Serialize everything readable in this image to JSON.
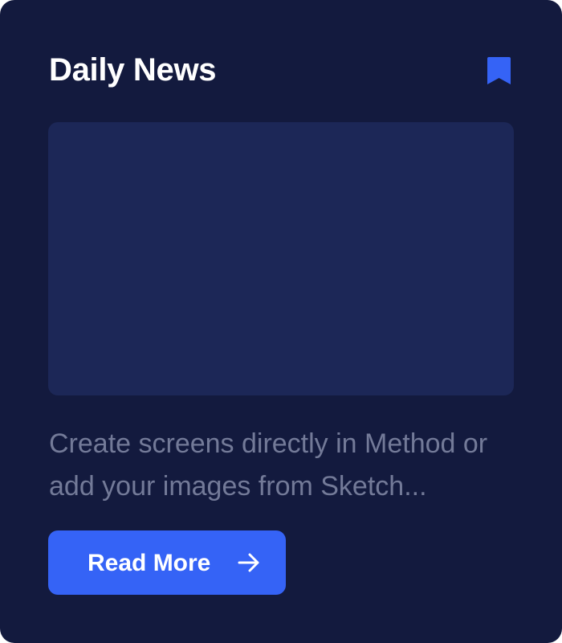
{
  "card": {
    "title": "Daily News",
    "bookmark_icon": "bookmark-icon",
    "excerpt": "Create screens directly in Method or add your images from Sketch...",
    "read_more_label": "Read More",
    "read_more_icon": "arrow-right-icon"
  },
  "colors": {
    "background": "#131a3e",
    "image_placeholder": "#1c2757",
    "accent": "#3563f6",
    "title": "#ffffff",
    "excerpt": "#737a98"
  }
}
